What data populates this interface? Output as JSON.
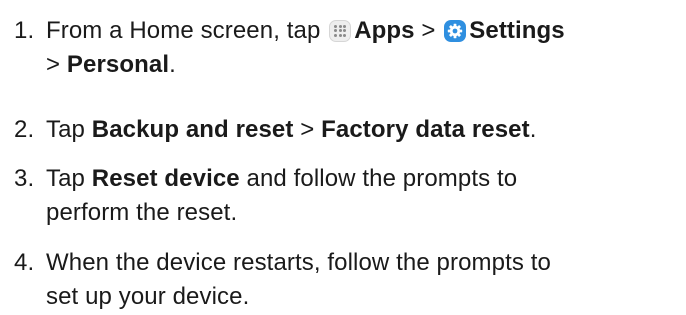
{
  "steps": [
    {
      "number": "1.",
      "text_before": "From a Home screen, tap",
      "apps_icon": "apps-grid-icon",
      "apps_label": "Apps",
      "separator_1": ">",
      "settings_icon": "gear-icon",
      "settings_label": "Settings",
      "separator_2": ">",
      "personal_label": "Personal",
      "end": "."
    },
    {
      "number": "2.",
      "text_before": "Tap",
      "item_1": "Backup and reset",
      "separator": ">",
      "item_2": "Factory data reset",
      "end": "."
    },
    {
      "number": "3.",
      "text_before": "Tap",
      "item_1": "Reset device",
      "text_after_1": "and follow the prompts to",
      "text_after_2": "perform the reset."
    },
    {
      "number": "4.",
      "line_1": "When the device restarts, follow the prompts to",
      "line_2": "set up your device."
    }
  ],
  "colors": {
    "text": "#1a1a1a",
    "settings_icon_bg": "#2f8fe0",
    "apps_icon_bg": "#eeeeee"
  }
}
